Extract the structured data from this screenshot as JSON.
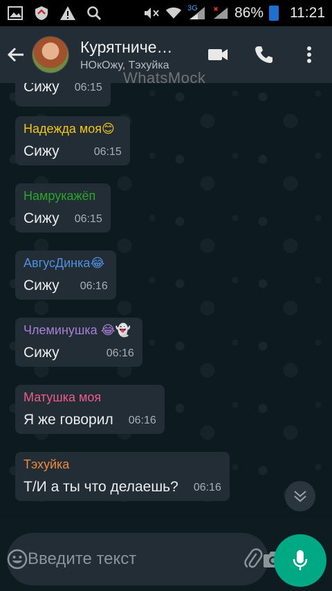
{
  "status_bar": {
    "left_icons": [
      "gallery-icon",
      "shield-icon",
      "warning-icon",
      "search-icon"
    ],
    "network": "3G",
    "battery_percent": "86%",
    "time": "11:21"
  },
  "header": {
    "title": "Курятниче…",
    "subtitle": "НОкОжу, Тэхуйка",
    "watermark": "WhatsMock",
    "icons": [
      "video-call-icon",
      "phone-icon",
      "more-vert-icon"
    ]
  },
  "messages": [
    {
      "sender": "",
      "sender_color": "#ffffff",
      "text": "Сижу",
      "time": "06:15"
    },
    {
      "sender": "Надежда моя😊",
      "sender_color": "#f5c518",
      "text": "Сижу",
      "time": "06:15"
    },
    {
      "sender": "Намрукажёп",
      "sender_color": "#2aa52a",
      "text": "Сижу",
      "time": "06:15"
    },
    {
      "sender": "АвгусДинка😂",
      "sender_color": "#4f8fe0",
      "text": "Сижу",
      "time": "06:16"
    },
    {
      "sender": "Члеминушка 😂👻",
      "sender_color": "#a77fd8",
      "text": "Сижу",
      "time": "06:16"
    },
    {
      "sender": "Матушка моя",
      "sender_color": "#ef5b8a",
      "text": "Я же говорил",
      "time": "06:16"
    },
    {
      "sender": "Тэхуйка",
      "sender_color": "#f08a3c",
      "text": "Т/И а ты что делаешь?",
      "time": "06:16"
    }
  ],
  "input": {
    "placeholder": "Введите текст",
    "value": ""
  },
  "colors": {
    "header_bg": "#232d36",
    "bubble_bg": "#232d36",
    "mic_bg": "#00a884"
  }
}
